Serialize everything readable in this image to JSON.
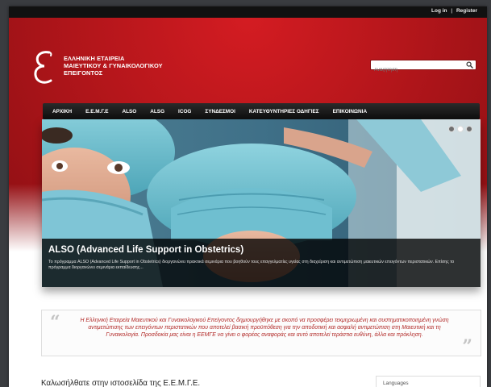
{
  "topbar": {
    "login": "Log in",
    "separator": "|",
    "register": "Register"
  },
  "logo": {
    "line1": "ΕΛΛΗΝΙΚΗ ΕΤΑΙΡΕΙΑ",
    "line2": "ΜΑΙΕΥΤΙΚΟΥ & ΓΥΝΑΙΚΟΛΟΓΙΚΟΥ",
    "line3": "ΕΠΕΙΓΟΝΤΟΣ"
  },
  "search": {
    "placeholder": "Αναζήτηση"
  },
  "nav": {
    "items": [
      "ΑΡΧΙΚΗ",
      "Ε.Ε.Μ.Γ.Ε",
      "ALSO",
      "ALSG",
      "ICOG",
      "ΣΥΝΔΕΣΜΟΙ",
      "ΚΑΤΕΥΘΥΝΤΗΡΙΕΣ ΟΔΗΓΙΕΣ",
      "ΕΠΙΚΟΙΝΩΝΙΑ"
    ]
  },
  "slider": {
    "title": "ALSO (Advanced Life Support in Obstetrics)",
    "body": "Το πρόγραμμα ALSO (Advanced Life Support in Obstetrics) διοργανώνει πρακτικά σεμινάρια που βοηθούν τους επαγγελματίες υγείας στη διαχείριση και αντιμετώπιση μαιευτικών επειγόντων περιστατικών. Επίσης το πρόγραμμα διοργανώνει σεμινάρια εκπαίδευσης...",
    "dots": 3,
    "active_dot": 2
  },
  "quote": {
    "text": "Η Ελληνική Εταιρεία Μαιευτικού και Γυναικολογικού Επείγοντος δημιουργήθηκε με σκοπό να προσφέρει τεκμηριωμένη και συστηματικοποιημένη γνώση αντιμετώπισης των επειγόντων περιστατικών που αποτελεί βασική προϋπόθεση για την αποδοτική και ασφαλή αντιμετώπιση στη Μαιευτική και τη Γυναικολογία. Προσδοκία μας είναι η ΕΕΜΓΕ να γίνει ο φορέας αναφοράς και αυτό αποτελεί τεράστια ευθύνη, άλλα και πρόκληση.",
    "open_mark": "“",
    "close_mark": "”"
  },
  "main": {
    "welcome": "Καλωσήλθατε στην ιστοσελίδα της Ε.Ε.Μ.Γ.Ε."
  },
  "sidebar": {
    "languages": "Languages"
  },
  "colors": {
    "brand_red": "#b5161b",
    "nav_dark": "#111111",
    "quote_red": "#b22a28"
  }
}
